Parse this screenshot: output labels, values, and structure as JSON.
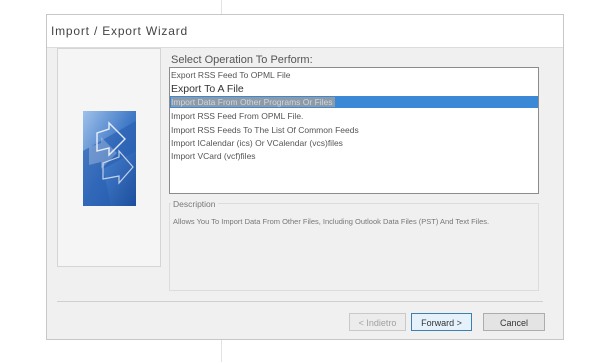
{
  "dialog": {
    "title": "Import / Export Wizard",
    "wizard_image_icon": "import-export-arrows-icon"
  },
  "operation": {
    "label": "Select Operation To Perform:",
    "items": [
      {
        "label": "Export RSS Feed To OPML File",
        "selected": false
      },
      {
        "label": "Export To A File",
        "selected": false
      },
      {
        "label": "Import Data From Other Programs Or Files",
        "selected": true
      },
      {
        "label": "Import RSS Feed From OPML File.",
        "selected": false
      },
      {
        "label": "Import RSS Feeds To The List Of Common Feeds",
        "selected": false
      },
      {
        "label": "Import ICalendar (ics) Or VCalendar (vcs)files",
        "selected": false
      },
      {
        "label": "Import VCard (vcf)files",
        "selected": false
      }
    ]
  },
  "description": {
    "label": "Description",
    "text": "Allows You To Import Data From Other Files, Including Outlook Data Files (PST) And Text Files."
  },
  "buttons": {
    "back": "< Indietro",
    "forward": "Forward >",
    "cancel": "Cancel"
  },
  "colors": {
    "selection": "#3b88d6",
    "dialog_bg": "#f0f0f0",
    "default_button_border": "#3c7fb1"
  }
}
